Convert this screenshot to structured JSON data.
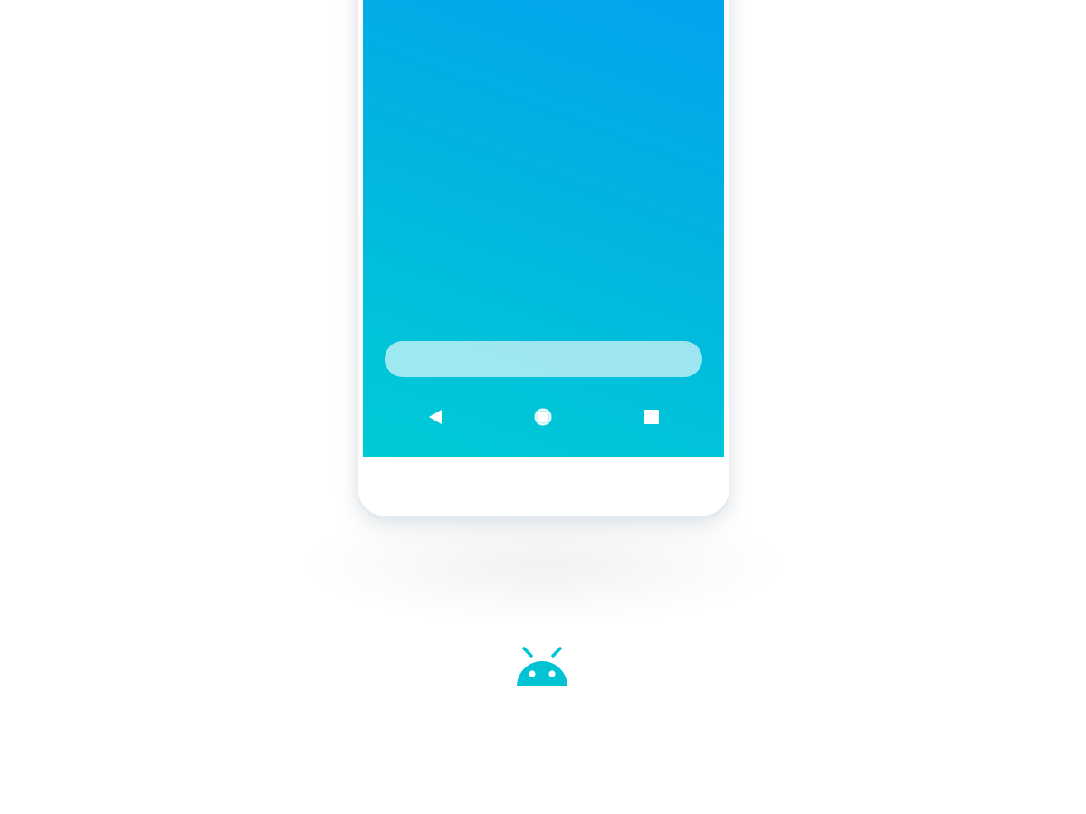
{
  "colors": {
    "screen_gradient_start": "#02a4ee",
    "screen_gradient_end": "#00cad6",
    "android_logo": "#00c4d4",
    "nav_icon": "#ffffff"
  },
  "device": {
    "search_bar": {
      "placeholder": ""
    },
    "navigation": {
      "back": "back-triangle-icon",
      "home": "home-circle-icon",
      "recents": "recents-square-icon"
    }
  },
  "branding": {
    "logo": "android-robot-head-icon"
  }
}
